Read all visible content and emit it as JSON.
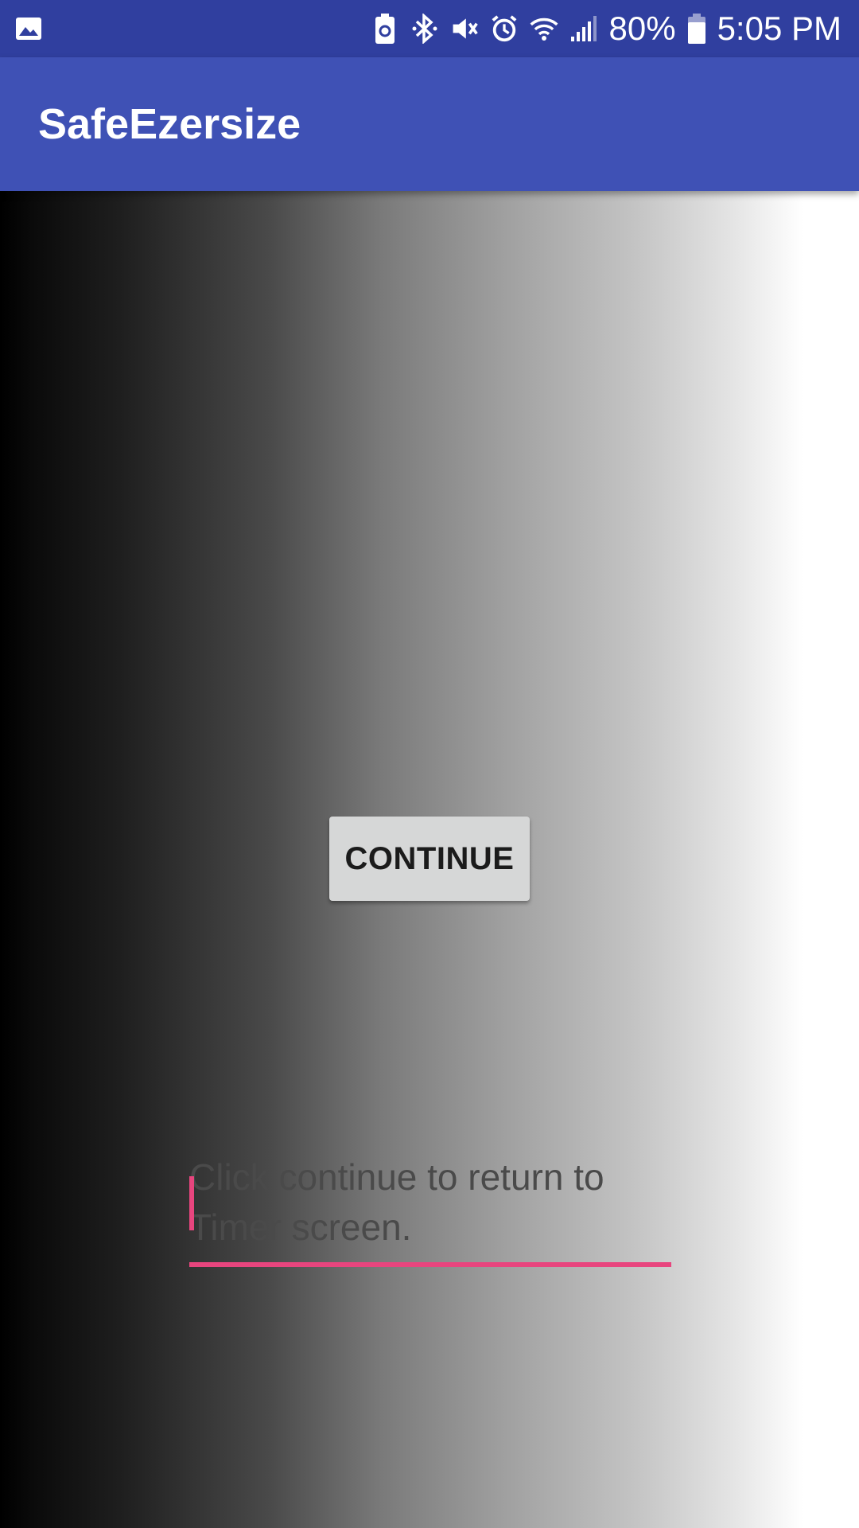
{
  "status_bar": {
    "battery_percent": "80%",
    "time": "5:05 PM",
    "icons": [
      "gallery-icon",
      "battery-saver-icon",
      "bluetooth-icon",
      "vibrate-mute-icon",
      "alarm-icon",
      "wifi-icon",
      "signal-icon",
      "battery-icon"
    ]
  },
  "app_bar": {
    "title": "SafeEzersize"
  },
  "main": {
    "continue_label": "CONTINUE",
    "message": "Click continue to return to\nTimer screen."
  },
  "colors": {
    "status_bar": "#303f9f",
    "app_bar": "#3f51b5",
    "accent": "#e8457e",
    "button": "#d6d7d7"
  }
}
